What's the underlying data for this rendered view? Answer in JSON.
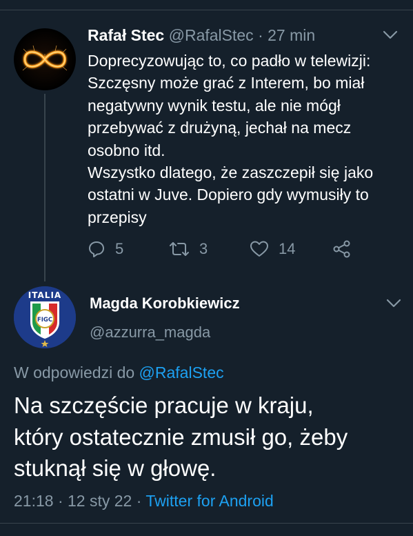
{
  "parent_tweet": {
    "author_name": "Rafał Stec",
    "handle": "@RafalStec",
    "separator": "·",
    "time": "27 min",
    "lines": [
      "Doprecyzowując to, co padło w telewizji:",
      "Szczęsny może grać z Interem, bo miał",
      "negatywny wynik testu, ale nie mógł",
      "przebywać z drużyną, jechał na mecz",
      "osobno itd.",
      "Wszystko dlatego, że zaszczepił się jako",
      "ostatni w Juve. Dopiero gdy wymusiły to",
      "przepisy"
    ],
    "actions": {
      "reply_icon": "reply-icon",
      "reply_count": "5",
      "retweet_icon": "retweet-icon",
      "retweet_count": "3",
      "like_icon": "heart-icon",
      "like_count": "14",
      "share_icon": "share-icon"
    }
  },
  "main_tweet": {
    "author_name": "Magda Korobkiewicz",
    "handle": "@azzurra_magda",
    "avatar_text": {
      "top": "ITALIA",
      "badge": "FIGC"
    },
    "reply_prefix": "W odpowiedzi do",
    "reply_to": "@RafalStec",
    "lines": [
      "Na szczęście pracuje w kraju,",
      "który ostatecznie zmusił go, żeby",
      "stuknął się w głowę."
    ],
    "time": "21:18",
    "separator": "·",
    "date": "12 sty 22",
    "source_separator": "·",
    "source": "Twitter for Android"
  },
  "colors": {
    "background": "#15202b",
    "text": "#ffffff",
    "muted": "#8899a6",
    "link": "#1da1f2",
    "divider": "#38444d"
  }
}
